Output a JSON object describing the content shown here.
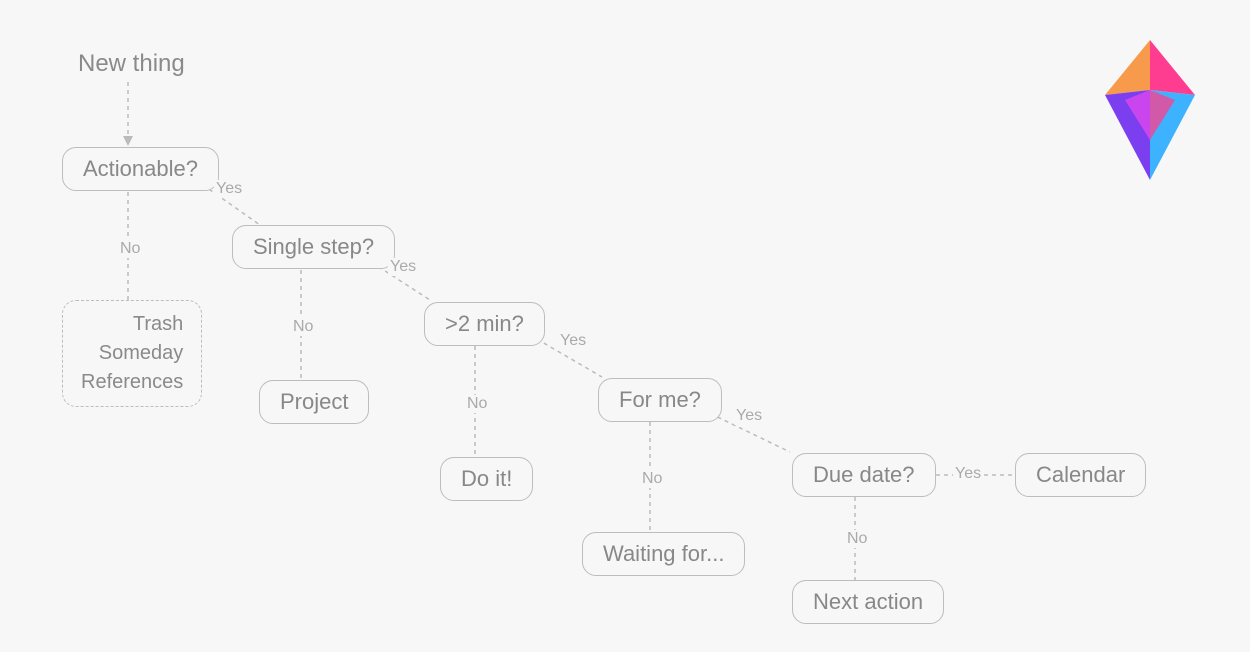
{
  "start": "New thing",
  "edges": {
    "yes": "Yes",
    "no": "No"
  },
  "nodes": {
    "actionable": "Actionable?",
    "single_step": "Single step?",
    "two_min": ">2 min?",
    "for_me": "For me?",
    "due_date": "Due date?",
    "calendar": "Calendar",
    "project": "Project",
    "do_it": "Do it!",
    "waiting": "Waiting for...",
    "next_action": "Next action"
  },
  "terminal": {
    "trash": "Trash",
    "someday": "Someday",
    "references": "References"
  }
}
